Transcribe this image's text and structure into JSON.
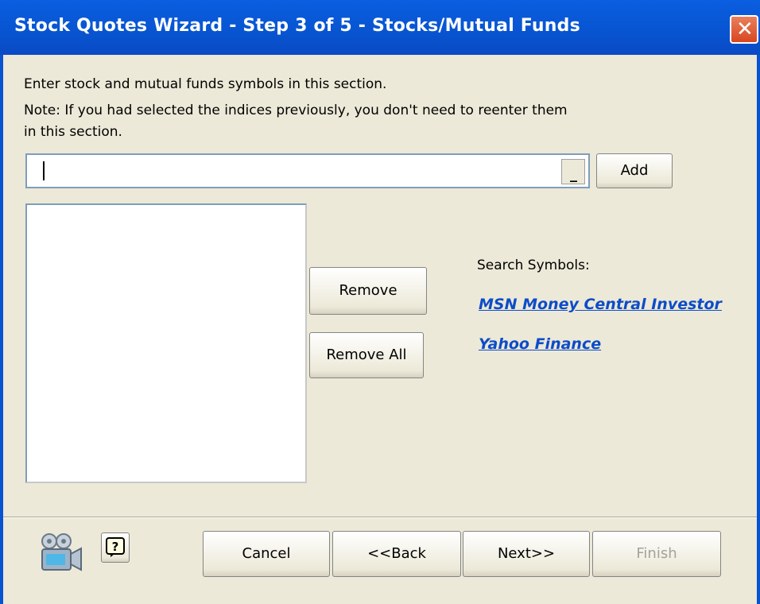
{
  "window": {
    "title": "Stock Quotes Wizard - Step 3 of 5 - Stocks/Mutual Funds"
  },
  "instructions": {
    "line1": "Enter stock and mutual funds symbols in this section.",
    "line2": "Note: If you had selected the indices previously, you don't need to reenter them",
    "line3": "in this section."
  },
  "symbol_input": {
    "value": ""
  },
  "buttons": {
    "add": "Add",
    "remove": "Remove",
    "remove_all": "Remove All",
    "cancel": "Cancel",
    "back": "<<Back",
    "next": "Next>>",
    "finish": "Finish"
  },
  "search": {
    "label": "Search Symbols:",
    "links": [
      "MSN Money Central Investor",
      "Yahoo Finance"
    ]
  },
  "colors": {
    "titlebar": "#0854d0",
    "dialog_bg": "#ece9d8",
    "link": "#0d4cc9"
  },
  "icons": [
    "close-icon",
    "dropdown-arrow-icon",
    "video-camera-icon",
    "help-icon"
  ]
}
